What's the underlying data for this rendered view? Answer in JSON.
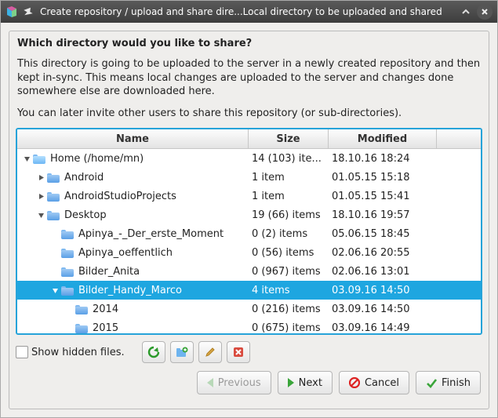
{
  "titlebar": {
    "text": "Create repository / upload and share dire...Local directory to be uploaded and shared"
  },
  "heading": "Which directory would you like to share?",
  "para1": "This directory is going to be uploaded to the server in a newly created repository and then kept in-sync. This means local changes are uploaded to the server and changes done somewhere else are downloaded here.",
  "para2": "You can later invite other users to share this repository (or sub-directories).",
  "columns": {
    "name": "Name",
    "size": "Size",
    "modified": "Modified"
  },
  "rows": [
    {
      "depth": 0,
      "arrow": "down",
      "icon": "home",
      "name": "Home (/home/mn)",
      "size": "14 (103) ite...",
      "mod": "18.10.16 18:24",
      "sel": false
    },
    {
      "depth": 1,
      "arrow": "right",
      "icon": "folder",
      "name": "Android",
      "size": "1 item",
      "mod": "01.05.15 15:18",
      "sel": false
    },
    {
      "depth": 1,
      "arrow": "right",
      "icon": "folder",
      "name": "AndroidStudioProjects",
      "size": "1 item",
      "mod": "01.05.15 15:41",
      "sel": false
    },
    {
      "depth": 1,
      "arrow": "down",
      "icon": "folder",
      "name": "Desktop",
      "size": "19 (66) items",
      "mod": "18.10.16 19:57",
      "sel": false
    },
    {
      "depth": 2,
      "arrow": "",
      "icon": "folder",
      "name": "Apinya_-_Der_erste_Moment",
      "size": "0 (2) items",
      "mod": "05.06.15 18:45",
      "sel": false
    },
    {
      "depth": 2,
      "arrow": "",
      "icon": "folder",
      "name": "Apinya_oeffentlich",
      "size": "0 (56) items",
      "mod": "02.06.16 20:55",
      "sel": false
    },
    {
      "depth": 2,
      "arrow": "",
      "icon": "folder",
      "name": "Bilder_Anita",
      "size": "0 (967) items",
      "mod": "02.06.16 13:01",
      "sel": false
    },
    {
      "depth": 2,
      "arrow": "down",
      "icon": "folder",
      "name": "Bilder_Handy_Marco",
      "size": "4 items",
      "mod": "03.09.16 14:50",
      "sel": true
    },
    {
      "depth": 3,
      "arrow": "",
      "icon": "folder",
      "name": "2014",
      "size": "0 (216) items",
      "mod": "03.09.16 14:50",
      "sel": false
    },
    {
      "depth": 3,
      "arrow": "",
      "icon": "folder",
      "name": "2015",
      "size": "0 (675) items",
      "mod": "03.09.16 14:49",
      "sel": false
    }
  ],
  "show_hidden_label": "Show hidden files.",
  "buttons": {
    "previous": "Previous",
    "next": "Next",
    "cancel": "Cancel",
    "finish": "Finish"
  }
}
